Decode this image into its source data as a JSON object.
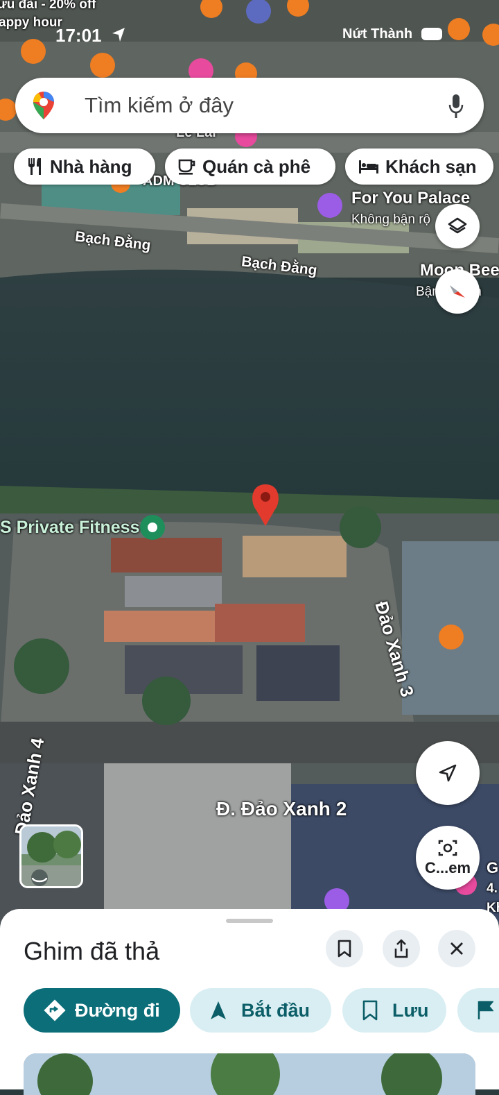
{
  "status_bar": {
    "time": "17:01",
    "carrier": "Nứt Thành"
  },
  "search": {
    "placeholder": "Tìm kiếm ở đây"
  },
  "chips": [
    {
      "label": "Nhà hàng",
      "icon": "restaurant-icon"
    },
    {
      "label": "Quán cà phê",
      "icon": "coffee-icon"
    },
    {
      "label": "Khách sạn",
      "icon": "hotel-icon"
    }
  ],
  "map_labels": {
    "promo_line1": "ưu đãi - 20% off",
    "promo_line2": "appy hour",
    "street_top": "Lê Lai",
    "club": "ADM CLUB",
    "hotel_name": "For You Palace",
    "hotel_sub": "Không bận rộ",
    "street_1": "Bạch Đằng",
    "street_2": "Bạch Đằng",
    "moon_name": "Moon Bee",
    "moon_sub": "Bận rơn bn",
    "fitness": "S Private Fitness",
    "dao_xanh_3": "Đảo Xanh 3",
    "dao_xanh_4": "Đảo Xanh 4",
    "dao_xanh_2": "Đ. Đảo Xanh 2",
    "edge_g": "G",
    "edge_4": "4.",
    "edge_k": "Kh"
  },
  "buttons": {
    "layers": "layers-icon",
    "compass": "compass-icon",
    "my_location": "navigation-arrow-icon",
    "lens_label": "C...em"
  },
  "sheet": {
    "title": "Ghim đã thả",
    "actions": [
      {
        "label": "Đường đi",
        "icon": "directions-icon"
      },
      {
        "label": "Bắt đầu",
        "icon": "navigation-icon"
      },
      {
        "label": "Lưu",
        "icon": "bookmark-icon"
      }
    ]
  },
  "colors": {
    "accent": "#0b6e78",
    "chip_light": "#d9eef3",
    "pin": "#e23b2e"
  }
}
